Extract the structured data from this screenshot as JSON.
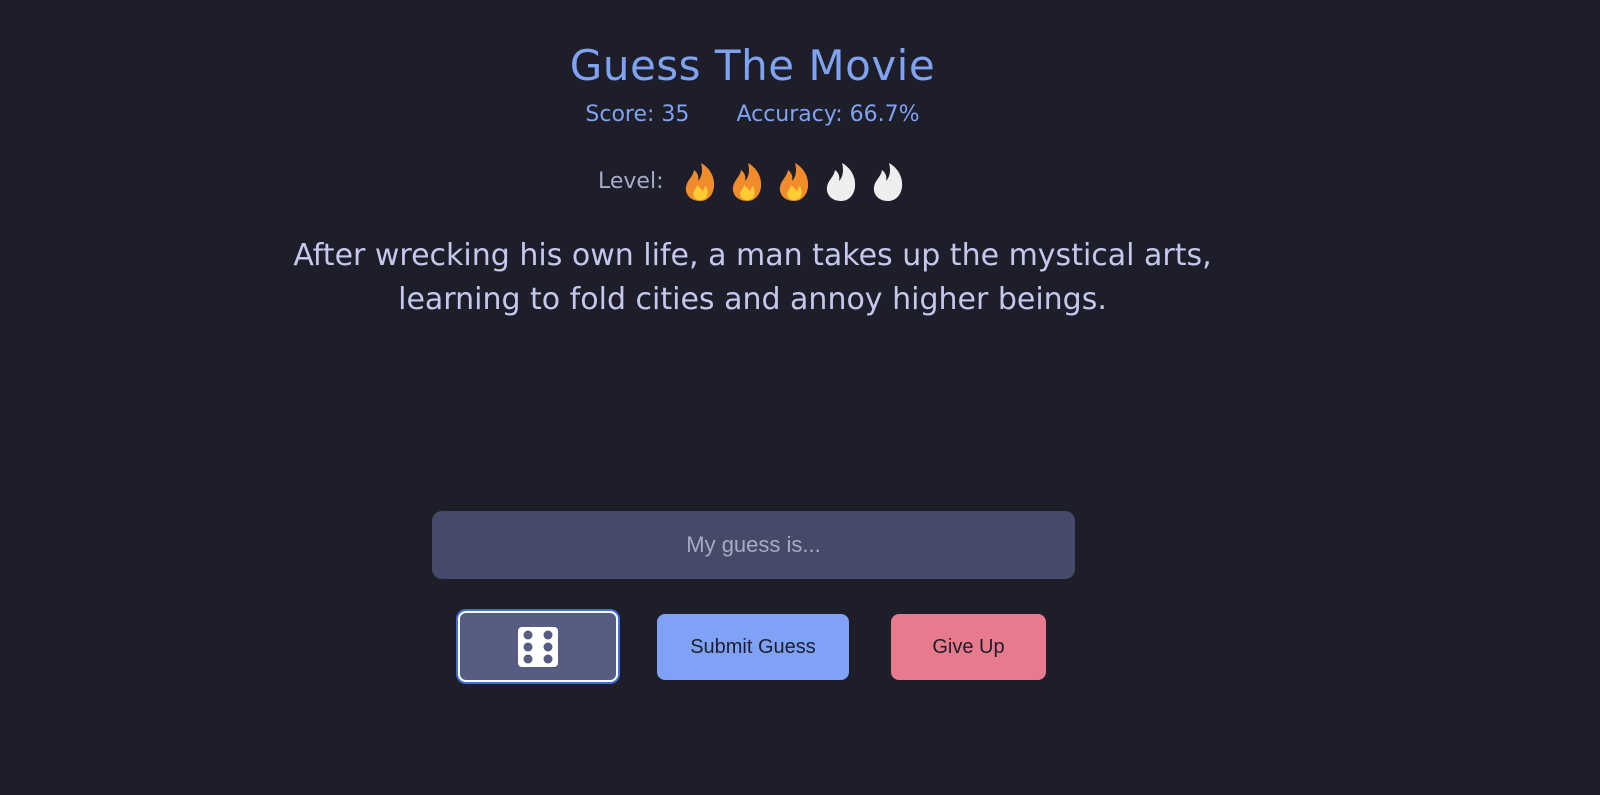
{
  "title": "Guess The Movie",
  "stats": {
    "score": "Score: 35",
    "accuracy": "Accuracy: 66.7%"
  },
  "level": {
    "label": "Level:",
    "value": 3,
    "max": 5,
    "icon": "flame-icon",
    "active_color": "#f08c2c",
    "inactive_color": "#eeeeee"
  },
  "clue": {
    "line1": "After wrecking his own life, a man takes up the mystical arts,",
    "line2": "learning to fold cities and annoy higher beings."
  },
  "guess_input": {
    "placeholder": "My guess is...",
    "value": ""
  },
  "buttons": {
    "random_icon": "dice-icon",
    "submit": "Submit Guess",
    "give_up": "Give Up"
  },
  "colors": {
    "background": "#1e1e2a",
    "accent": "#7fa2f1",
    "submit": "#7fa2f7",
    "give_up": "#e87a8e"
  }
}
